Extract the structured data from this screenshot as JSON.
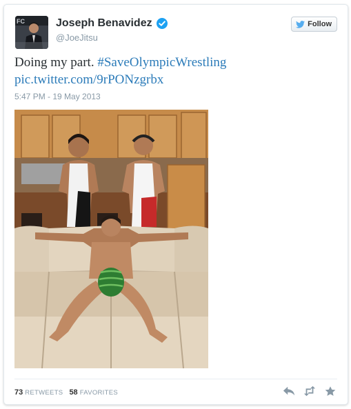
{
  "user": {
    "name": "Joseph Benavidez",
    "handle": "@JoeJitsu",
    "verified": true
  },
  "follow_button": {
    "label": "Follow"
  },
  "tweet": {
    "text_prefix": "Doing my part. ",
    "hashtag": "#SaveOlympicWrestling",
    "link": "pic.twitter.com/9rPONzgrbx",
    "timestamp": "5:47 PM - 19 May 2013"
  },
  "stats": {
    "retweets_count": "73",
    "retweets_label": "RETWEETS",
    "favorites_count": "58",
    "favorites_label": "FAVORITES"
  },
  "actions": [
    "reply-icon",
    "retweet-icon",
    "favorite-icon"
  ],
  "colors": {
    "link": "#2b7bb9",
    "verified": "#1da1f2",
    "twitter_bird": "#55acee",
    "muted": "#8899a6"
  }
}
